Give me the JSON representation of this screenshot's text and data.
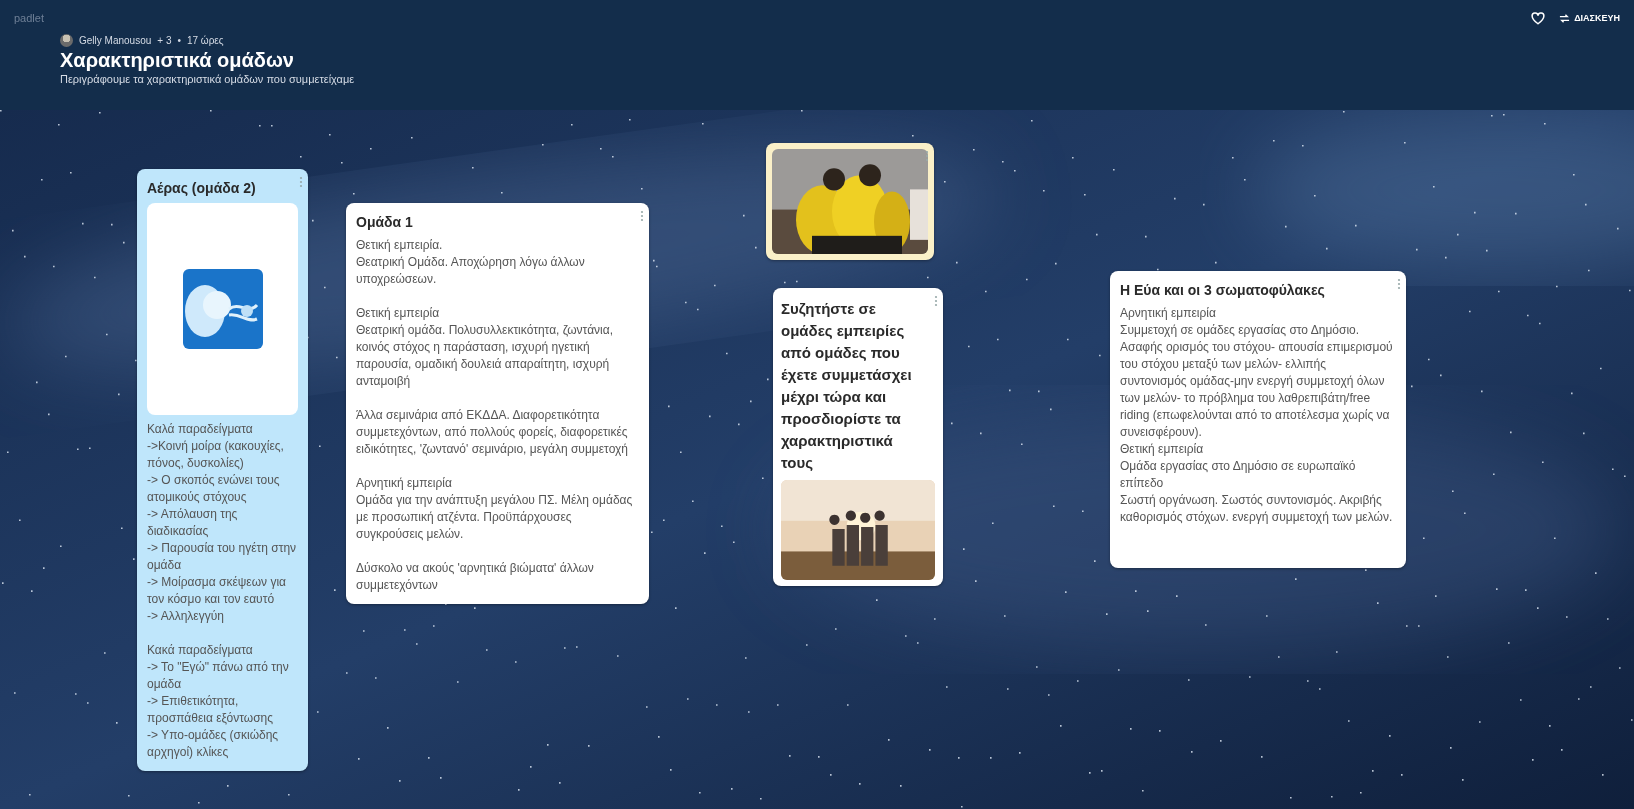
{
  "app": {
    "logo": "padlet"
  },
  "header": {
    "author": "Gelly Manousou",
    "contributors": "+ 3",
    "separator": "•",
    "time": "17 ώρες",
    "title": "Χαρακτηριστικά ομάδων",
    "description": "Περιγράφουμε τα χαρακτηριστικά ομάδων που συμμετείχαμε",
    "actions": [
      {
        "kind": "like"
      },
      {
        "kind": "remix",
        "label": "ΔΙΑΣΚΕΥΗ"
      }
    ]
  },
  "posts": [
    {
      "kind": "note",
      "color": "#bfe6fb",
      "title": "Αέρας (ομάδα 2)",
      "attachment": {
        "kind": "clipart"
      },
      "paragraphs": [
        "Καλά παραδείγματα\n->Κοινή μοίρα (κακουχίες, πόνος, δυσκολίες)\n-> Ο σκοπός ενώνει τους ατομικούς στόχους\n-> Απόλαυση της διαδικασίας\n-> Παρουσία του ηγέτη στην ομάδα\n-> Μοίρασμα σκέψεων για τον κόσμο και τον εαυτό\n-> Αλληλεγγύη",
        "Κακά παραδείγματα\n-> Το \"Εγώ\" πάνω από την ομάδα\n-> Επιθετικότητα, προσπάθεια εξόντωσης\n-> Υπο-ομάδες (σκιώδης αρχηγοί) κλίκες"
      ]
    },
    {
      "kind": "note",
      "color": "#ffffff",
      "title": "Ομάδα 1",
      "paragraphs": [
        "Θετική εμπειρία.\nΘεατρική Ομάδα. Αποχώρηση λόγω άλλων υποχρεώσεων.",
        "Θετική εμπειρία\nΘεατρική ομάδα. Πολυσυλλεκτικότητα, ζωντάνια, κοινός στόχος η παράσταση, ισχυρή ηγετική παρουσία, ομαδική δουλειά απαραίτητη, ισχυρή ανταμοιβή",
        "Άλλα σεμινάρια από ΕΚΔΔΑ. Διαφορετικότητα συμμετεχόντων, από πολλούς φορείς, διαφορετικές ειδικότητες, 'ζωντανό' σεμινάριο, μεγάλη συμμετοχή",
        "Αρνητική εμπειρία\nΟμάδα για την ανάπτυξη μεγάλου ΠΣ. Μέλη ομάδας με προσωπική ατζέντα. Προϋπάρχουσες συγκρούσεις μελών.",
        "Δύσκολο να ακούς 'αρνητικά βιώματα' άλλων συμμετεχόντων"
      ]
    },
    {
      "color": "#faf0c8",
      "attachment": {
        "kind": "team"
      }
    },
    {
      "kind": "prompt",
      "color": "#ffffff",
      "title": "Συζητήστε σε ομάδες εμπειρίες από ομάδες που έχετε συμμετάσχει μέχρι τώρα και προσδιορίστε τα χαρακτηριστικά τους",
      "attachment": {
        "kind": "sunset"
      }
    },
    {
      "kind": "note",
      "color": "#ffffff",
      "title": "Η Εύα και οι 3 σωματοφύλακες",
      "paragraphs": [
        "Αρνητική εμπειρία\nΣυμμετοχή σε ομάδες εργασίας στο Δημόσιο. Ασαφής ορισμός του στόχου- απουσία επιμερισμού του στόχου μεταξύ των μελών- ελλιπής συντονισμός ομάδας-μην ενεργή συμμετοχή όλων των μελών- το πρόβλημα του λαθρεπιβάτη/free riding (επωφελούνται από το αποτέλεσμα χωρίς να συνεισφέρουν).\nΘετική εμπειρία\nΟμάδα εργασίας στο Δημόσιο σε ευρωπαϊκό επίπεδο\nΣωστή οργάνωση. Σωστός συντονισμός. Ακριβής καθορισμός στόχων. ενεργή συμμετοχή των μελών."
      ]
    }
  ]
}
